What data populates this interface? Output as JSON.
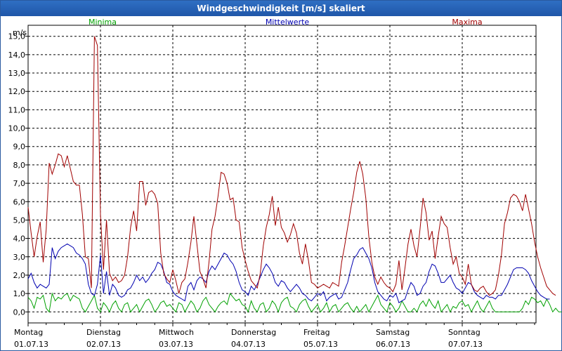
{
  "window": {
    "title": "Windgeschwindigkeit [m/s] skaliert"
  },
  "chart_data": {
    "type": "line",
    "title": "Windgeschwindigkeit [m/s] skaliert",
    "ylabel": "m/s",
    "ylim": [
      -0.6,
      15.6
    ],
    "yticks": [
      "0,0",
      "1,0",
      "2,0",
      "3,0",
      "4,0",
      "5,0",
      "6,0",
      "7,0",
      "8,0",
      "9,0",
      "10,0",
      "11,0",
      "12,0",
      "13,0",
      "14,0",
      "15,0"
    ],
    "ytick_values": [
      0,
      1,
      2,
      3,
      4,
      5,
      6,
      7,
      8,
      9,
      10,
      11,
      12,
      13,
      14,
      15
    ],
    "grid": true,
    "legend_position": "top",
    "x_days": [
      {
        "day": "Montag",
        "date": "01.07.13"
      },
      {
        "day": "Dienstag",
        "date": "02.07.13"
      },
      {
        "day": "Mittwoch",
        "date": "03.07.13"
      },
      {
        "day": "Donnerstag",
        "date": "04.07.13"
      },
      {
        "day": "Freitag",
        "date": "05.07.13"
      },
      {
        "day": "Samstag",
        "date": "06.07.13"
      },
      {
        "day": "Sonntag",
        "date": "07.07.13"
      }
    ],
    "samples_per_day": 24,
    "series": [
      {
        "name": "Minima",
        "color": "#00a000",
        "values": [
          0.8,
          0.6,
          0.2,
          0.8,
          0.7,
          0.9,
          0.2,
          0.0,
          1.0,
          0.6,
          0.8,
          0.7,
          0.9,
          1.0,
          0.6,
          0.9,
          0.8,
          0.7,
          0.2,
          0.0,
          0.3,
          0.6,
          0.9,
          0.2,
          0.0,
          0.5,
          0.3,
          0.0,
          0.4,
          0.6,
          0.2,
          0.0,
          0.4,
          0.5,
          0.0,
          0.2,
          0.4,
          0.0,
          0.3,
          0.6,
          0.7,
          0.4,
          0.0,
          0.2,
          0.5,
          0.6,
          0.3,
          0.4,
          0.2,
          0.0,
          0.5,
          0.4,
          0.0,
          0.3,
          0.6,
          0.4,
          0.0,
          0.2,
          0.6,
          0.8,
          0.4,
          0.2,
          0.0,
          0.3,
          0.5,
          0.6,
          0.4,
          1.0,
          0.8,
          0.6,
          0.7,
          0.4,
          0.3,
          0.0,
          0.6,
          0.2,
          0.0,
          0.4,
          0.5,
          0.0,
          0.2,
          0.6,
          0.4,
          0.0,
          0.5,
          0.7,
          0.8,
          0.3,
          0.2,
          0.0,
          0.4,
          0.6,
          0.7,
          0.3,
          0.0,
          0.2,
          0.4,
          0.0,
          0.2,
          0.5,
          0.0,
          0.3,
          0.4,
          0.0,
          0.2,
          0.4,
          0.5,
          0.2,
          0.0,
          0.3,
          0.0,
          0.2,
          0.4,
          0.0,
          0.3,
          0.6,
          0.9,
          0.4,
          0.2,
          0.0,
          0.5,
          0.3,
          0.0,
          0.2,
          0.6,
          0.3,
          0.0,
          0.0,
          0.2,
          0.0,
          0.4,
          0.6,
          0.3,
          0.7,
          0.4,
          0.2,
          0.6,
          0.0,
          0.2,
          0.4,
          0.0,
          0.3,
          0.2,
          0.5,
          0.6,
          0.3,
          0.4,
          0.0,
          0.3,
          0.6,
          0.2,
          0.0,
          0.3,
          0.6,
          0.2,
          0.0,
          0.0,
          0.0,
          0.0,
          0.0,
          0.0,
          0.0,
          0.0,
          0.0,
          0.2,
          0.6,
          0.4,
          0.8,
          0.7,
          0.5,
          0.6,
          0.3,
          0.7,
          0.4,
          0.0,
          0.2,
          0.0,
          0.0
        ]
      },
      {
        "name": "Mittelwerte",
        "color": "#0000b0",
        "values": [
          1.8,
          2.1,
          1.6,
          1.3,
          1.5,
          1.4,
          1.3,
          1.5,
          3.5,
          2.9,
          3.3,
          3.5,
          3.6,
          3.7,
          3.6,
          3.5,
          3.2,
          3.1,
          2.9,
          2.6,
          1.5,
          1.0,
          0.9,
          1.5,
          3.1,
          1.0,
          2.2,
          0.9,
          1.5,
          1.3,
          0.9,
          0.8,
          0.9,
          1.2,
          1.3,
          1.6,
          2.0,
          1.7,
          1.9,
          1.6,
          1.8,
          2.1,
          2.3,
          2.7,
          2.6,
          2.2,
          1.6,
          1.5,
          1.1,
          0.9,
          0.8,
          0.7,
          0.6,
          1.4,
          1.6,
          1.2,
          1.7,
          1.9,
          1.8,
          1.6,
          2.2,
          2.5,
          2.3,
          2.6,
          2.9,
          3.2,
          3.1,
          2.8,
          2.6,
          2.2,
          1.6,
          1.2,
          1.1,
          0.9,
          1.4,
          1.2,
          1.5,
          1.9,
          2.3,
          2.6,
          2.4,
          2.1,
          1.6,
          1.4,
          1.7,
          1.6,
          1.3,
          1.1,
          1.3,
          1.5,
          1.3,
          1.0,
          0.9,
          0.7,
          0.6,
          0.8,
          1.0,
          0.9,
          1.1,
          0.6,
          0.8,
          0.9,
          1.0,
          0.7,
          0.8,
          1.2,
          1.6,
          2.3,
          2.9,
          3.1,
          3.4,
          3.5,
          3.2,
          2.9,
          2.4,
          1.6,
          1.1,
          0.9,
          0.7,
          0.6,
          0.9,
          0.8,
          1.0,
          0.5,
          0.6,
          0.7,
          1.2,
          1.6,
          1.4,
          0.9,
          1.0,
          1.4,
          1.6,
          2.2,
          2.6,
          2.5,
          2.1,
          1.6,
          1.6,
          1.8,
          2.0,
          1.6,
          1.3,
          1.2,
          1.0,
          1.3,
          1.6,
          1.5,
          1.1,
          0.9,
          0.8,
          0.7,
          0.9,
          0.8,
          0.8,
          0.7,
          0.9,
          0.9,
          1.2,
          1.5,
          1.9,
          2.3,
          2.4,
          2.4,
          2.4,
          2.3,
          2.1,
          1.7,
          1.4,
          1.1,
          0.9,
          0.8,
          0.7,
          0.7
        ]
      },
      {
        "name": "Maxima",
        "color": "#a00000",
        "values": [
          5.7,
          4.3,
          3.0,
          4.1,
          4.9,
          2.7,
          4.5,
          8.1,
          7.5,
          8.0,
          8.6,
          8.5,
          7.9,
          8.5,
          7.8,
          7.1,
          6.9,
          6.9,
          5.3,
          3.0,
          2.9,
          1.3,
          15.0,
          14.5,
          5.3,
          2.3,
          5.0,
          2.1,
          1.7,
          1.9,
          1.6,
          1.7,
          2.0,
          3.0,
          4.6,
          5.5,
          4.4,
          7.1,
          7.1,
          5.8,
          6.5,
          6.6,
          6.4,
          5.9,
          3.2,
          2.1,
          1.8,
          1.6,
          2.3,
          1.7,
          1.0,
          1.6,
          1.8,
          2.7,
          3.8,
          5.2,
          3.7,
          2.2,
          1.8,
          1.3,
          2.7,
          4.5,
          5.2,
          6.3,
          7.6,
          7.5,
          7.0,
          6.1,
          6.2,
          5.0,
          4.9,
          3.5,
          2.8,
          2.2,
          1.7,
          1.5,
          1.3,
          2.1,
          3.6,
          4.6,
          5.3,
          6.3,
          4.7,
          5.7,
          4.6,
          4.3,
          3.8,
          4.2,
          4.8,
          4.3,
          3.2,
          2.6,
          3.7,
          2.8,
          1.6,
          1.5,
          1.3,
          1.4,
          1.5,
          1.4,
          1.3,
          1.6,
          1.5,
          1.4,
          2.7,
          3.6,
          4.6,
          5.6,
          6.5,
          7.6,
          8.2,
          7.5,
          6.2,
          4.1,
          2.7,
          1.9,
          1.5,
          1.9,
          1.6,
          1.4,
          1.3,
          1.1,
          1.5,
          2.8,
          1.2,
          2.4,
          3.7,
          4.5,
          3.6,
          3.0,
          4.5,
          6.2,
          5.4,
          3.9,
          4.4,
          2.9,
          4.1,
          5.2,
          4.8,
          4.6,
          3.5,
          2.6,
          3.0,
          2.1,
          1.9,
          1.5,
          2.6,
          1.5,
          1.2,
          1.1,
          1.3,
          1.4,
          1.1,
          0.9,
          1.0,
          1.2,
          2.0,
          3.1,
          4.8,
          5.4,
          6.2,
          6.4,
          6.3,
          6.0,
          5.5,
          6.4,
          5.6,
          4.8,
          3.8,
          3.0,
          2.4,
          1.9,
          1.4,
          1.2,
          1.0,
          0.9
        ]
      }
    ]
  }
}
